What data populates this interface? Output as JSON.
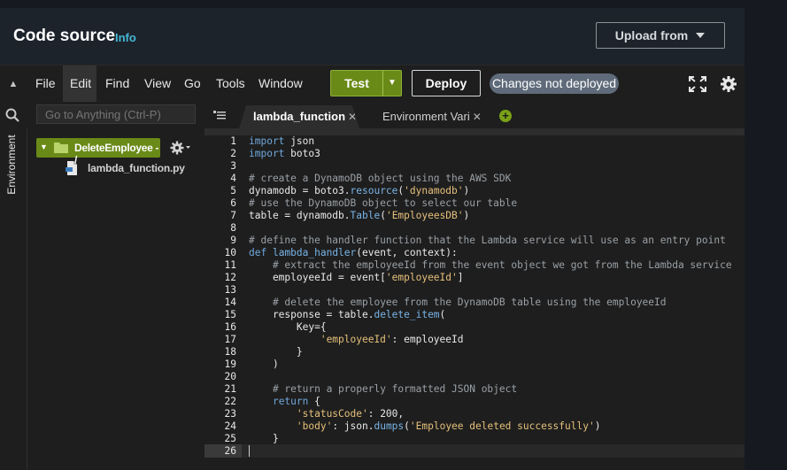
{
  "header": {
    "title": "Code source",
    "info_link": "Info",
    "upload_button": "Upload from"
  },
  "toolbar": {
    "menus": [
      "File",
      "Edit",
      "Find",
      "View",
      "Go",
      "Tools",
      "Window"
    ],
    "active_menu": "Edit",
    "test_button": "Test",
    "deploy_button": "Deploy",
    "status_badge": "Changes not deployed"
  },
  "search": {
    "placeholder": "Go to Anything (Ctrl-P)"
  },
  "tabs": [
    {
      "label": "lambda_function",
      "active": true
    },
    {
      "label": "Environment Vari",
      "active": false
    }
  ],
  "sidebar": {
    "rail_label": "Environment",
    "root_folder": "DeleteEmployee - /",
    "files": [
      "lambda_function.py"
    ]
  },
  "editor": {
    "line_numbers": [
      "1",
      "2",
      "3",
      "4",
      "5",
      "6",
      "7",
      "8",
      "9",
      "10",
      "11",
      "12",
      "13",
      "14",
      "15",
      "16",
      "17",
      "18",
      "19",
      "20",
      "21",
      "22",
      "23",
      "24",
      "25",
      "26"
    ],
    "active_line": "26"
  },
  "colors": {
    "accent_green": "#6a8a18",
    "link_blue": "#44b9d6",
    "badge_gray": "#5f6b7a"
  }
}
